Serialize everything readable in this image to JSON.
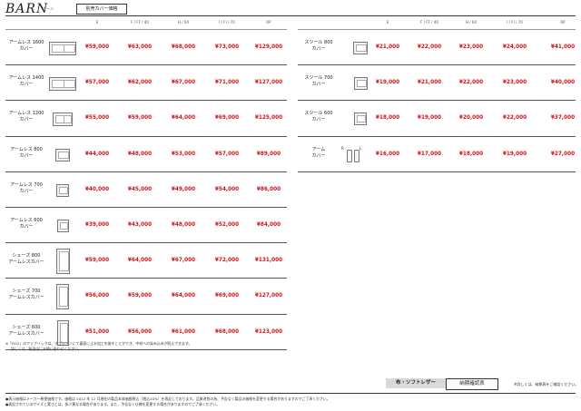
{
  "brand": {
    "title": "BARN",
    "subtitle": "バーン",
    "badge": "別売カバー価格"
  },
  "columns": [
    "E",
    "F / FF / 40",
    "H / 60",
    "I / FI / 70",
    "RP"
  ],
  "left_rows": [
    {
      "name": [
        "アームレス 1600",
        "カバー"
      ],
      "prices": [
        "¥59,000",
        "¥63,000",
        "¥68,000",
        "¥73,000",
        "¥129,000"
      ]
    },
    {
      "name": [
        "アームレス 1400",
        "カバー"
      ],
      "prices": [
        "¥57,000",
        "¥62,000",
        "¥67,000",
        "¥71,000",
        "¥127,000"
      ]
    },
    {
      "name": [
        "アームレス 1200",
        "カバー"
      ],
      "prices": [
        "¥55,000",
        "¥59,000",
        "¥64,000",
        "¥69,000",
        "¥125,000"
      ]
    },
    {
      "name": [
        "アームレス 800",
        "カバー"
      ],
      "prices": [
        "¥44,000",
        "¥48,000",
        "¥53,000",
        "¥57,000",
        "¥89,000"
      ]
    },
    {
      "name": [
        "アームレス 700",
        "カバー"
      ],
      "prices": [
        "¥40,000",
        "¥45,000",
        "¥49,000",
        "¥54,000",
        "¥86,000"
      ]
    },
    {
      "name": [
        "アームレス 600",
        "カバー"
      ],
      "prices": [
        "¥39,000",
        "¥43,000",
        "¥48,000",
        "¥52,000",
        "¥84,000"
      ]
    },
    {
      "name": [
        "シェーズ 800",
        "アームレスカバー"
      ],
      "prices": [
        "¥59,000",
        "¥64,000",
        "¥67,000",
        "¥72,000",
        "¥131,000"
      ]
    },
    {
      "name": [
        "シェーズ 700",
        "アームレスカバー"
      ],
      "prices": [
        "¥56,000",
        "¥59,000",
        "¥64,000",
        "¥69,000",
        "¥127,000"
      ]
    },
    {
      "name": [
        "シェーズ 600",
        "アームレスカバー"
      ],
      "prices": [
        "¥51,000",
        "¥56,000",
        "¥61,000",
        "¥68,000",
        "¥123,000"
      ]
    }
  ],
  "right_rows": [
    {
      "name": [
        "スツール 800",
        "カバー"
      ],
      "prices": [
        "¥21,000",
        "¥22,000",
        "¥23,000",
        "¥24,000",
        "¥41,000"
      ]
    },
    {
      "name": [
        "スツール 700",
        "カバー"
      ],
      "prices": [
        "¥19,000",
        "¥21,000",
        "¥22,000",
        "¥23,000",
        "¥40,000"
      ]
    },
    {
      "name": [
        "スツール 600",
        "カバー"
      ],
      "prices": [
        "¥18,000",
        "¥19,000",
        "¥20,000",
        "¥22,000",
        "¥37,000"
      ]
    },
    {
      "name": [
        "アーム",
        "カバー"
      ],
      "prices": [
        "¥16,000",
        "¥17,000",
        "¥18,000",
        "¥19,000",
        "¥27,000"
      ],
      "arm_labels": [
        "R",
        "L"
      ]
    }
  ],
  "notes": {
    "fabric_note_1": "※「RG2」のファブリックは、オプションにて裏面に止水加工を施すことができ、中材への染み込みが防止できます。",
    "fabric_note_2": "詳しくは、販売店にお問い合わせください。",
    "footer_1": "●表示価格はメーカー希望価格です。価格は 2022 年 12 月現在の製品本体価格税込（税込10%）を表記しております。品質改良の為、予告なく製品の価格を変更する場合がありますのでご了承ください。",
    "footer_2": "●表記されているサイズと実寸とは、多少異なる場合があります。また、予告なく仕様を変更する場合がありますのでご了承ください。",
    "delivery_note": "※詳しくは、納期表をご確認ください。"
  },
  "buttons": {
    "fabric_softleather": "布・ソフトレザー",
    "delivery_check": "納期確認表"
  },
  "colors": {
    "price_red": "#d0121b",
    "tab_grey": "#d9d9d9"
  }
}
